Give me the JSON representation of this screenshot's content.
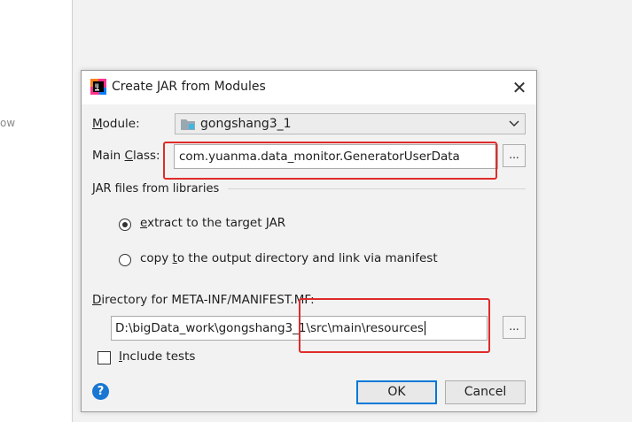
{
  "background": {
    "fragment_text": "ow"
  },
  "dialog": {
    "title": "Create JAR from Modules",
    "app_icon": "intellij-icon",
    "close_symbol": "✕",
    "module": {
      "label_u": "M",
      "label_rest": "odule:",
      "value": "gongshang3_1",
      "icon": "folder-icon"
    },
    "main_class": {
      "label_pre": "Main ",
      "label_u": "C",
      "label_post": "lass:",
      "value": "com.yuanma.data_monitor.GeneratorUserData",
      "browse": "..."
    },
    "jar_files": {
      "heading": "JAR files from libraries",
      "option1": {
        "u": "e",
        "rest": "xtract to the target JAR",
        "selected": true
      },
      "option2": {
        "pre": "copy ",
        "u": "t",
        "rest": "o the output directory and link via manifest",
        "selected": false
      }
    },
    "manifest": {
      "label_u": "D",
      "label_rest": "irectory for META-INF/MANIFEST.MF:",
      "value": "D:\\bigData_work\\gongshang3_1\\src\\main\\resources",
      "browse": "..."
    },
    "include_tests": {
      "label_u": "I",
      "label_rest": "nclude tests",
      "checked": false
    },
    "help_symbol": "?",
    "ok_label": "OK",
    "cancel_label": "Cancel"
  },
  "colors": {
    "highlight": "#e02a2a",
    "focus": "#0078d7",
    "help": "#1976d2"
  }
}
